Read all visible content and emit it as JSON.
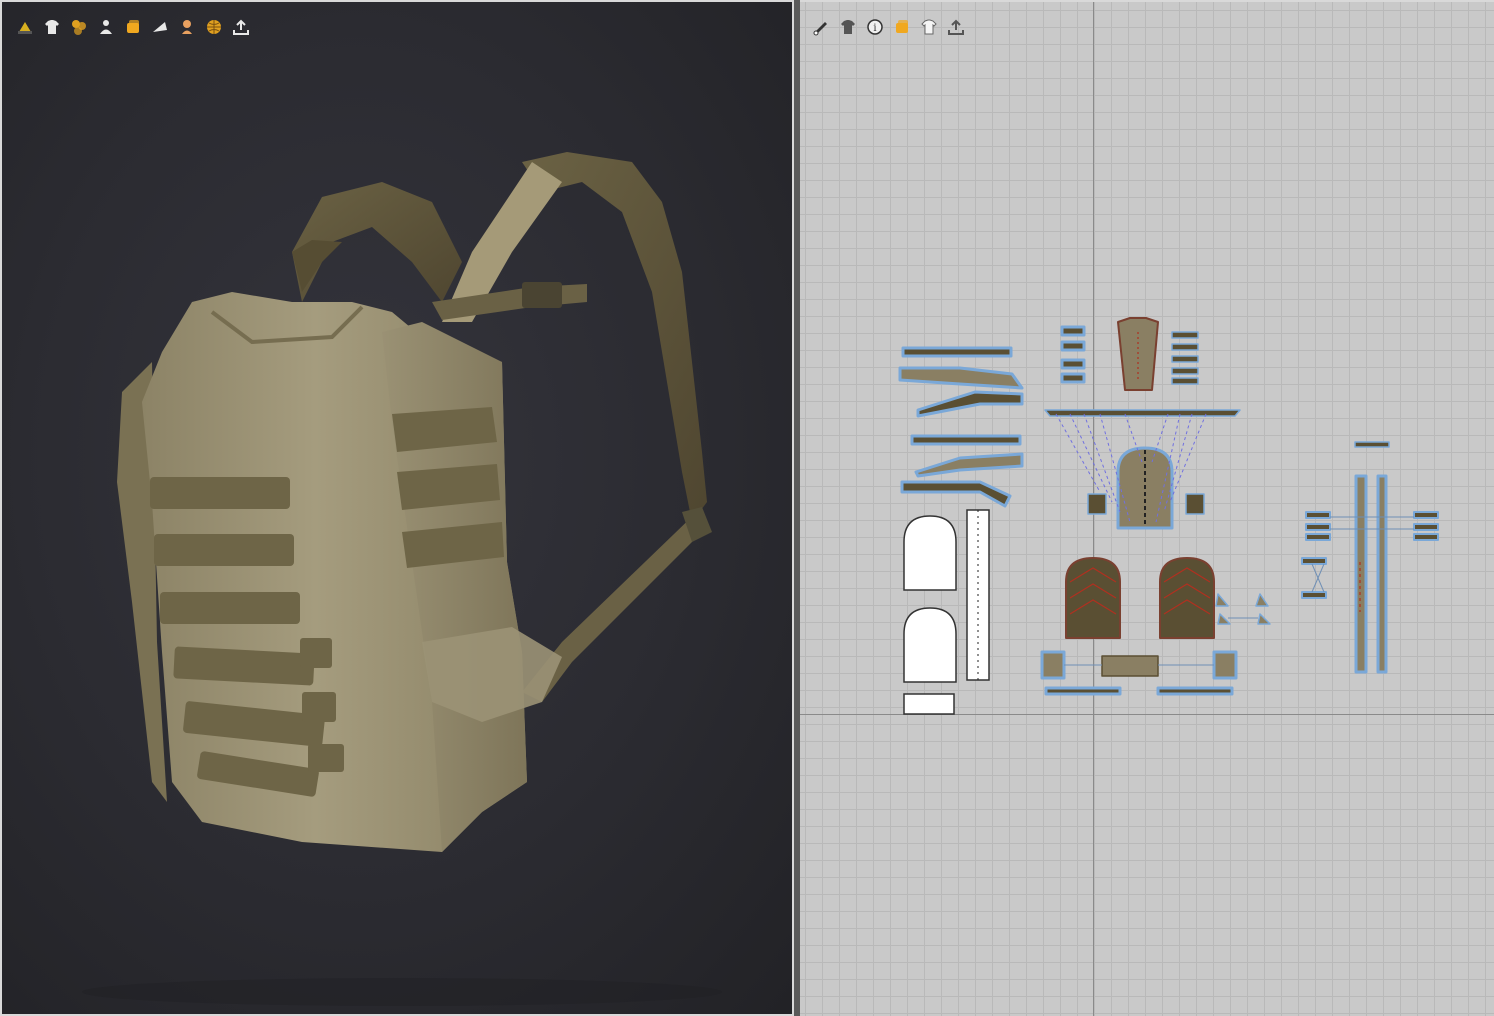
{
  "viewport3d": {
    "toolbar": [
      {
        "icon": "add-avatar-icon",
        "color": "#d8b020"
      },
      {
        "icon": "garment-shirt-icon",
        "color": "#e8e8e8"
      },
      {
        "icon": "texture-swatch-icon",
        "color": "#e0a020"
      },
      {
        "icon": "avatar-display-icon",
        "color": "#e8e8e8"
      },
      {
        "icon": "fabric-layer-icon",
        "color": "#f0a820"
      },
      {
        "icon": "render-mode-icon",
        "color": "#e8e8e8"
      },
      {
        "icon": "avatar-skin-icon",
        "color": "#e8a060"
      },
      {
        "icon": "globe-environment-icon",
        "color": "#e0a020"
      },
      {
        "icon": "export-tray-icon",
        "color": "#e8e8e8"
      }
    ],
    "model": "backpack"
  },
  "viewport2d": {
    "toolbar": [
      {
        "icon": "pattern-edit-icon",
        "color": "#333333"
      },
      {
        "icon": "garment-shirt-icon",
        "color": "#555555"
      },
      {
        "icon": "info-tag-icon",
        "color": "#333333"
      },
      {
        "icon": "fabric-layer-icon",
        "color": "#f0a820"
      },
      {
        "icon": "garment-outline-icon",
        "color": "#666666"
      },
      {
        "icon": "export-tray-icon",
        "color": "#555555"
      }
    ]
  },
  "colors": {
    "fabric": "#8a7f63",
    "strap": "#5a4f33",
    "outline": "#7aa8d8"
  }
}
